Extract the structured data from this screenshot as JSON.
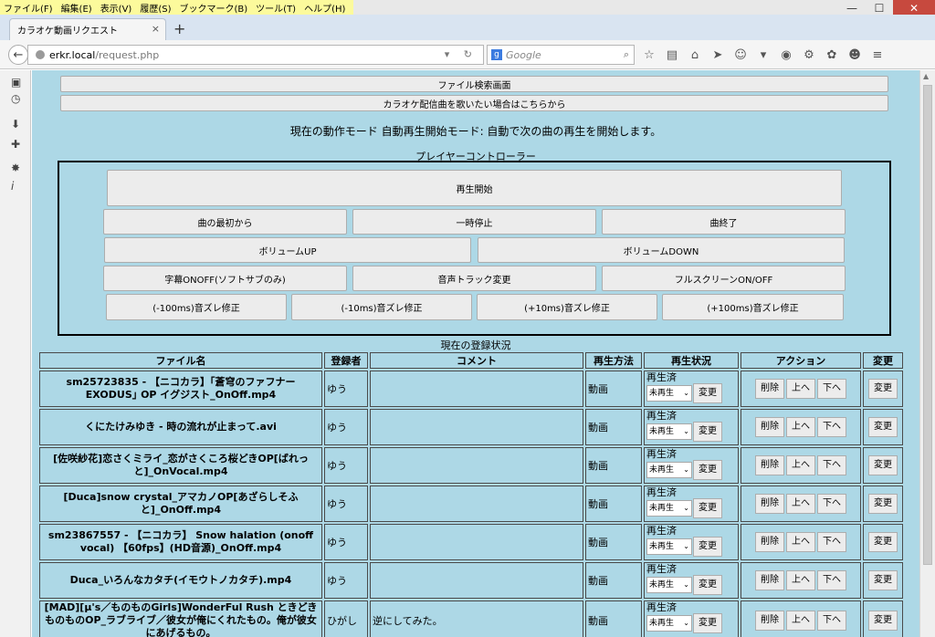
{
  "menu": [
    "ファイル(F)",
    "編集(E)",
    "表示(V)",
    "履歴(S)",
    "ブックマーク(B)",
    "ツール(T)",
    "ヘルプ(H)"
  ],
  "window_controls": {
    "minimize": "—",
    "maximize": "☐",
    "close": "✕"
  },
  "tab": {
    "title": "カラオケ動画リクエスト",
    "close": "×",
    "new": "+"
  },
  "nav": {
    "url_host": "erkr.local",
    "url_path": "/request.php",
    "search_placeholder": "Google",
    "search_engine_glyph": "g"
  },
  "page": {
    "top_buttons": [
      "ファイル検索画面",
      "カラオケ配信曲を歌いたい場合はこちらから"
    ],
    "mode_text": "現在の動作モード 自動再生開始モード: 自動で次の曲の再生を開始します。",
    "controller_title": "プレイヤーコントローラー",
    "controls": {
      "play": "再生開始",
      "row1": [
        "曲の最初から",
        "一時停止",
        "曲終了"
      ],
      "row2": [
        "ボリュームUP",
        "ボリュームDOWN"
      ],
      "row3": [
        "字幕ONOFF(ソフトサブのみ)",
        "音声トラック変更",
        "フルスクリーンON/OFF"
      ],
      "row4": [
        "(-100ms)音ズレ修正",
        "(-10ms)音ズレ修正",
        "(+10ms)音ズレ修正",
        "(+100ms)音ズレ修正"
      ]
    },
    "registration_title": "現在の登録状況",
    "table": {
      "headers": [
        "ファイル名",
        "登録者",
        "コメント",
        "再生方法",
        "再生状況",
        "アクション",
        "変更"
      ],
      "rows": [
        {
          "file": "sm25723835 - 【ニコカラ】｢蒼穹のファフナー EXODUS｣ OP イグジスト_OnOff.mp4",
          "user": "ゆう",
          "comment": "",
          "method": "動画",
          "status": "再生済",
          "select": "未再生",
          "status_btn": "変更",
          "actions": [
            "削除",
            "上へ",
            "下へ"
          ],
          "change": "変更"
        },
        {
          "file": "くにたけみゆき - 時の流れが止まって.avi",
          "user": "ゆう",
          "comment": "",
          "method": "動画",
          "status": "再生済",
          "select": "未再生",
          "status_btn": "変更",
          "actions": [
            "削除",
            "上へ",
            "下へ"
          ],
          "change": "変更"
        },
        {
          "file": "[佐咲紗花]恋さくミライ_恋がさくころ桜どきOP[ばれっと]_OnVocal.mp4",
          "user": "ゆう",
          "comment": "",
          "method": "動画",
          "status": "再生済",
          "select": "未再生",
          "status_btn": "変更",
          "actions": [
            "削除",
            "上へ",
            "下へ"
          ],
          "change": "変更"
        },
        {
          "file": "[Duca]snow crystal_アマカノOP[あざらしそふと]_OnOff.mp4",
          "user": "ゆう",
          "comment": "",
          "method": "動画",
          "status": "再生済",
          "select": "未再生",
          "status_btn": "変更",
          "actions": [
            "削除",
            "上へ",
            "下へ"
          ],
          "change": "変更"
        },
        {
          "file": "sm23867557 - 【ニコカラ】 Snow halation (onoff vocal) 【60fps】(HD音源)_OnOff.mp4",
          "user": "ゆう",
          "comment": "",
          "method": "動画",
          "status": "再生済",
          "select": "未再生",
          "status_btn": "変更",
          "actions": [
            "削除",
            "上へ",
            "下へ"
          ],
          "change": "変更"
        },
        {
          "file": "Duca_いろんなカタチ(イモウトノカタチ).mp4",
          "user": "ゆう",
          "comment": "",
          "method": "動画",
          "status": "再生済",
          "select": "未再生",
          "status_btn": "変更",
          "actions": [
            "削除",
            "上へ",
            "下へ"
          ],
          "change": "変更"
        },
        {
          "file": "[MAD][μ's／ものものGirls]WonderFul Rush ときどき ものものOP_ラブライブ／彼女が俺にくれたもの。俺が彼女にあげるもの。",
          "user": "ひがし",
          "comment": "逆にしてみた。",
          "method": "動画",
          "status": "再生済",
          "select": "未再生",
          "status_btn": "変更",
          "actions": [
            "削除",
            "上へ",
            "下へ"
          ],
          "change": "変更"
        }
      ]
    }
  },
  "icons": {
    "back": "back-arrow-icon",
    "reload": "reload-icon",
    "search": "search-icon",
    "star": "bookmark-star-icon",
    "home": "home-icon"
  }
}
